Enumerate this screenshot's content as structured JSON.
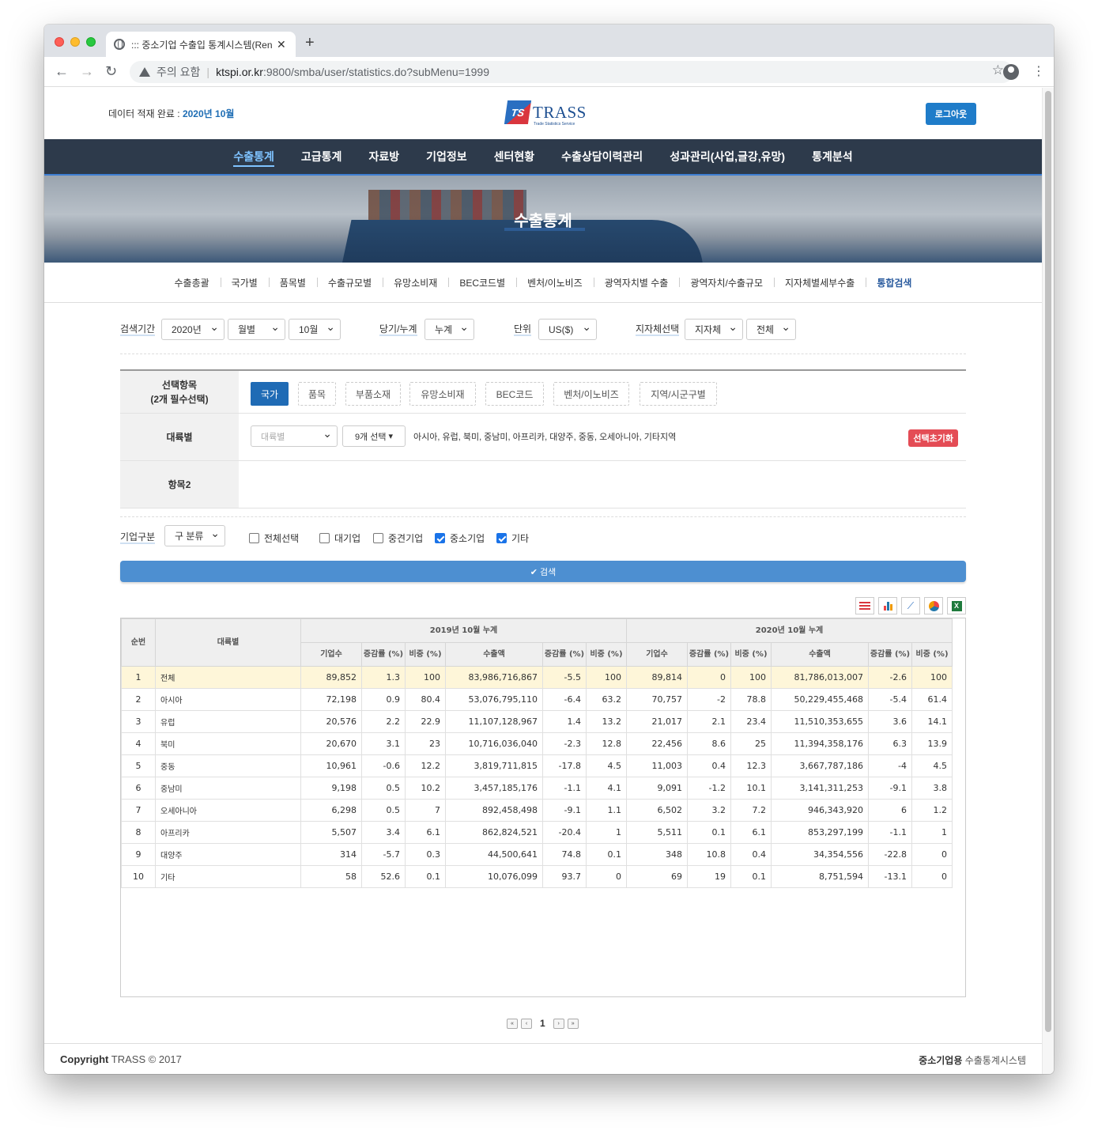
{
  "browser": {
    "tab_title": "::: 중소기업 수출입 통계시스템(Renewal)",
    "warning_label": "주의 요함",
    "url_host": "ktspi.or.kr",
    "url_rest": ":9800/smba/user/statistics.do?subMenu=1999"
  },
  "header": {
    "data_status_prefix": "데이터 적재 완료 : ",
    "data_status_value": "2020년 10월",
    "logo_badge": "TS",
    "logo_text": "TRASS",
    "logo_sub": "Trade Statistics Service",
    "logout_label": "로그아웃"
  },
  "gnb": [
    "수출통계",
    "고급통계",
    "자료방",
    "기업정보",
    "센터현황",
    "수출상담이력관리",
    "성과관리(사업,글강,유망)",
    "통계분석"
  ],
  "hero_title": "수출통계",
  "lnb": [
    "수출총괄",
    "국가별",
    "품목별",
    "수출규모별",
    "유망소비재",
    "BEC코드별",
    "벤처/이노비즈",
    "광역자치별 수출",
    "광역자치/수출규모",
    "지자체별세부수출",
    "통합검색"
  ],
  "filters": {
    "period_label": "검색기간",
    "year": "2020년",
    "period_type": "월별",
    "month": "10월",
    "cumulative_label": "당기/누계",
    "cumulative": "누계",
    "unit_label": "단위",
    "unit": "US($)",
    "local_label": "지자체선택",
    "local_type": "지자체",
    "local_value": "전체"
  },
  "selection": {
    "row1_label_1": "선택항목",
    "row1_label_2": "(2개 필수선택)",
    "chips": [
      "국가",
      "품목",
      "부품소재",
      "유망소비재",
      "BEC코드",
      "벤처/이노비즈",
      "지역/시군구별"
    ],
    "row2_label": "대륙별",
    "continent_placeholder": "대륙별",
    "count_selected": "9개 선택",
    "selected_list": "아시아, 유럽, 북미, 중남미, 아프리카, 대양주, 중동, 오세아니아, 기타지역",
    "reset_label": "선택초기화",
    "row3_label": "항목2"
  },
  "company": {
    "label": "기업구분",
    "select": "구 분류",
    "checkboxes": [
      {
        "label": "전체선택",
        "checked": false
      },
      {
        "label": "대기업",
        "checked": false
      },
      {
        "label": "중견기업",
        "checked": false
      },
      {
        "label": "중소기업",
        "checked": true
      },
      {
        "label": "기타",
        "checked": true
      }
    ]
  },
  "search_label": "✔ 검색",
  "tools": [
    "list-icon",
    "bar-chart-icon",
    "line-chart-icon",
    "pie-chart-icon",
    "excel-icon"
  ],
  "grid": {
    "h_no": "순번",
    "h_cat": "대륙별",
    "h_2019": "2019년 10월 누계",
    "h_2020": "2020년 10월 누계",
    "sub": [
      "기업수",
      "증감률 (%)",
      "비중 (%)",
      "수출액",
      "증감률 (%)",
      "비중 (%)"
    ],
    "rows": [
      [
        "1",
        "전체",
        "89,852",
        "1.3",
        "100",
        "83,986,716,867",
        "-5.5",
        "100",
        "89,814",
        "0",
        "100",
        "81,786,013,007",
        "-2.6",
        "100"
      ],
      [
        "2",
        "아시아",
        "72,198",
        "0.9",
        "80.4",
        "53,076,795,110",
        "-6.4",
        "63.2",
        "70,757",
        "-2",
        "78.8",
        "50,229,455,468",
        "-5.4",
        "61.4"
      ],
      [
        "3",
        "유럽",
        "20,576",
        "2.2",
        "22.9",
        "11,107,128,967",
        "1.4",
        "13.2",
        "21,017",
        "2.1",
        "23.4",
        "11,510,353,655",
        "3.6",
        "14.1"
      ],
      [
        "4",
        "북미",
        "20,670",
        "3.1",
        "23",
        "10,716,036,040",
        "-2.3",
        "12.8",
        "22,456",
        "8.6",
        "25",
        "11,394,358,176",
        "6.3",
        "13.9"
      ],
      [
        "5",
        "중동",
        "10,961",
        "-0.6",
        "12.2",
        "3,819,711,815",
        "-17.8",
        "4.5",
        "11,003",
        "0.4",
        "12.3",
        "3,667,787,186",
        "-4",
        "4.5"
      ],
      [
        "6",
        "중남미",
        "9,198",
        "0.5",
        "10.2",
        "3,457,185,176",
        "-1.1",
        "4.1",
        "9,091",
        "-1.2",
        "10.1",
        "3,141,311,253",
        "-9.1",
        "3.8"
      ],
      [
        "7",
        "오세아니아",
        "6,298",
        "0.5",
        "7",
        "892,458,498",
        "-9.1",
        "1.1",
        "6,502",
        "3.2",
        "7.2",
        "946,343,920",
        "6",
        "1.2"
      ],
      [
        "8",
        "아프리카",
        "5,507",
        "3.4",
        "6.1",
        "862,824,521",
        "-20.4",
        "1",
        "5,511",
        "0.1",
        "6.1",
        "853,297,199",
        "-1.1",
        "1"
      ],
      [
        "9",
        "대양주",
        "314",
        "-5.7",
        "0.3",
        "44,500,641",
        "74.8",
        "0.1",
        "348",
        "10.8",
        "0.4",
        "34,354,556",
        "-22.8",
        "0"
      ],
      [
        "10",
        "기타",
        "58",
        "52.6",
        "0.1",
        "10,076,099",
        "93.7",
        "0",
        "69",
        "19",
        "0.1",
        "8,751,594",
        "-13.1",
        "0"
      ]
    ]
  },
  "pager": {
    "current": "1"
  },
  "footer": {
    "copy_bold": "Copyright",
    "copy_rest": " TRASS © 2017",
    "sys_bold": "중소기업용",
    "sys_rest": " 수출통계시스템"
  }
}
